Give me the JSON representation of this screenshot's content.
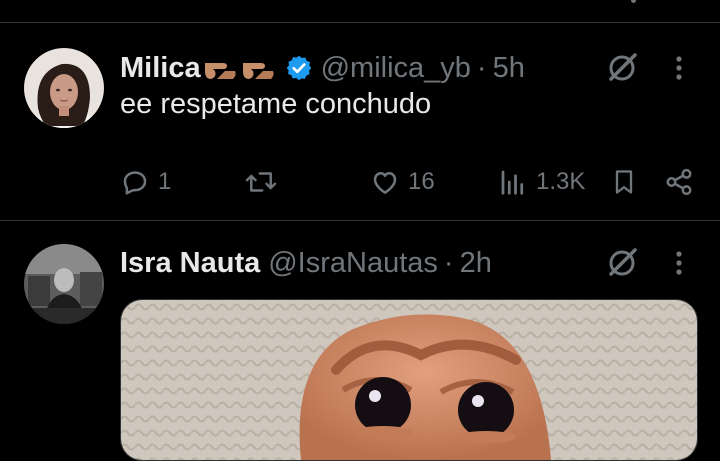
{
  "tweets": [
    {
      "author": {
        "name": "Milica",
        "name_emoji": "👉👉",
        "handle": "@milica_yb",
        "verified": true
      },
      "separator": "·",
      "time": "5h",
      "text": "ee respetame conchudo",
      "actions": {
        "replies": "1",
        "retweets": "",
        "likes": "16",
        "views": "1.3K"
      }
    },
    {
      "author": {
        "name": "Isra Nauta",
        "handle": "@IsraNautas",
        "verified": false
      },
      "separator": "·",
      "time": "2h",
      "has_media": true
    }
  ],
  "colors": {
    "background": "#000000",
    "text": "#e7e9ea",
    "muted": "#71767b",
    "verified_blue": "#1d9bf0",
    "divider": "#2f3336"
  }
}
